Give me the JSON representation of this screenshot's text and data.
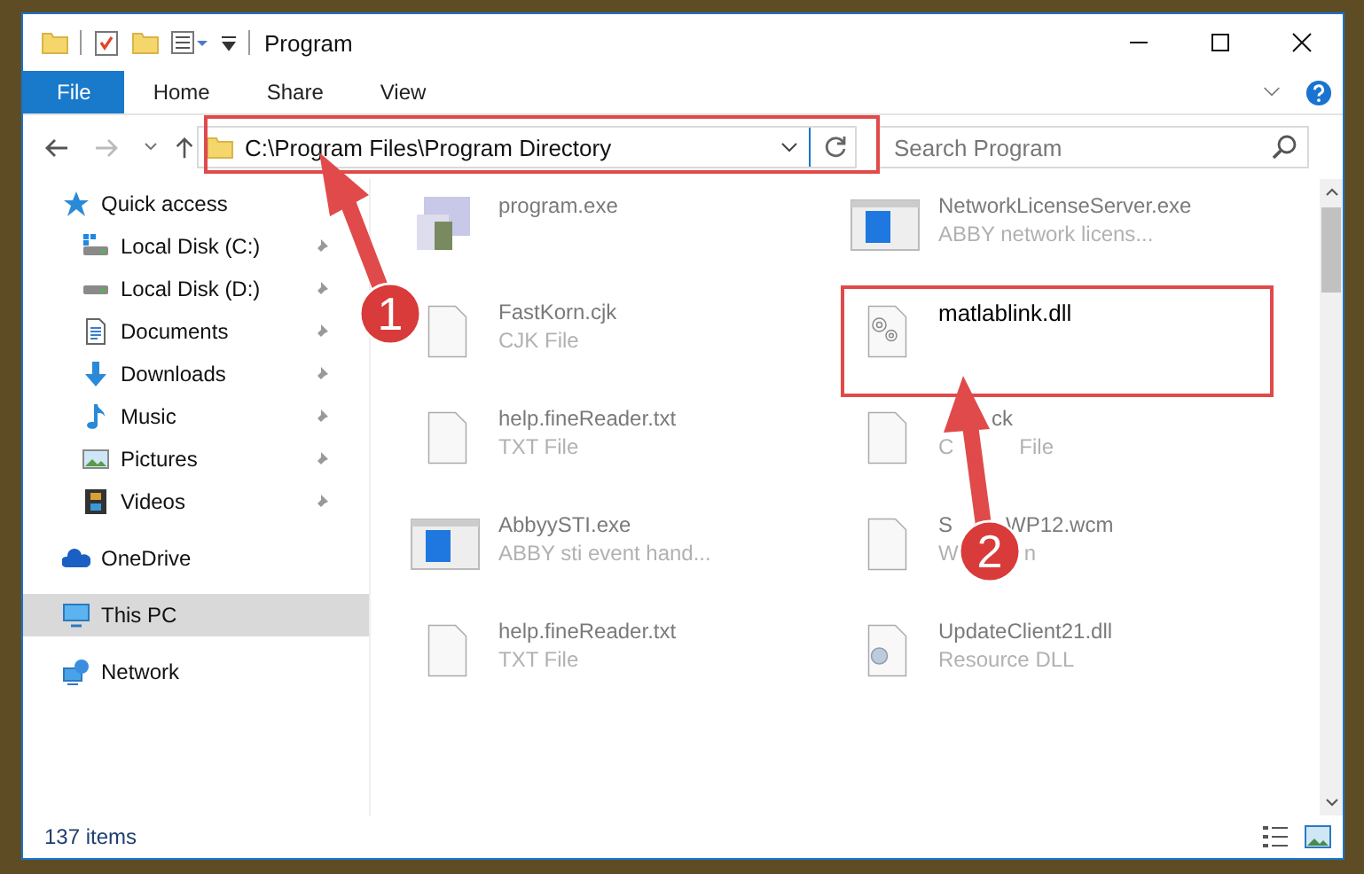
{
  "window": {
    "title": "Program"
  },
  "ribbon_tabs": [
    {
      "label": "File",
      "selected": true
    },
    {
      "label": "Home",
      "selected": false
    },
    {
      "label": "Share",
      "selected": false
    },
    {
      "label": "View",
      "selected": false
    }
  ],
  "address_bar": {
    "path": "C:\\Program Files\\Program Directory"
  },
  "search": {
    "placeholder": "Search Program"
  },
  "sidebar": {
    "items": [
      {
        "label": "Quick access",
        "kind": "quick",
        "selected": false,
        "children": [
          {
            "label": "Local Disk (C:)",
            "kind": "diskc",
            "pinned": true
          },
          {
            "label": "Local Disk (D:)",
            "kind": "disk",
            "pinned": true
          },
          {
            "label": "Documents",
            "kind": "documents",
            "pinned": true
          },
          {
            "label": "Downloads",
            "kind": "downloads",
            "pinned": true
          },
          {
            "label": "Music",
            "kind": "music",
            "pinned": true
          },
          {
            "label": "Pictures",
            "kind": "pictures",
            "pinned": true
          },
          {
            "label": "Videos",
            "kind": "videos",
            "pinned": true
          }
        ]
      },
      {
        "label": "OneDrive",
        "kind": "cloud",
        "selected": false
      },
      {
        "label": "This PC",
        "kind": "pc",
        "selected": true
      },
      {
        "label": "Network",
        "kind": "network",
        "selected": false
      }
    ]
  },
  "files": [
    {
      "name": "program.exe",
      "kind": "exe"
    },
    {
      "name": "NetworkLicenseServer.exe",
      "type": "ABBY network licens...",
      "kind": "app"
    },
    {
      "name": "FastKorn.cjk",
      "type": "CJK File",
      "kind": "blank"
    },
    {
      "name": "matlablink.dll",
      "kind": "dll",
      "highlighted": true
    },
    {
      "name": "help.fineReader.txt",
      "type": "TXT File",
      "kind": "blank"
    },
    {
      "name": [
        "ck"
      ],
      "type": [
        "C",
        "File"
      ],
      "kind": "blank",
      "name_covered_start": true
    },
    {
      "name": "AbbyySTI.exe",
      "type": "ABBY sti event hand...",
      "kind": "app"
    },
    {
      "name": [
        "S",
        "WP12.wcm"
      ],
      "type": [
        "W",
        "n"
      ],
      "kind": "blank"
    },
    {
      "name": "help.fineReader.txt",
      "type": "TXT File",
      "kind": "blank"
    },
    {
      "name": "UpdateClient21.dll",
      "type": "Resource DLL",
      "kind": "resource"
    }
  ],
  "status_bar": {
    "items": "137 items"
  },
  "annotations": [
    {
      "number": "1"
    },
    {
      "number": "2"
    }
  ]
}
